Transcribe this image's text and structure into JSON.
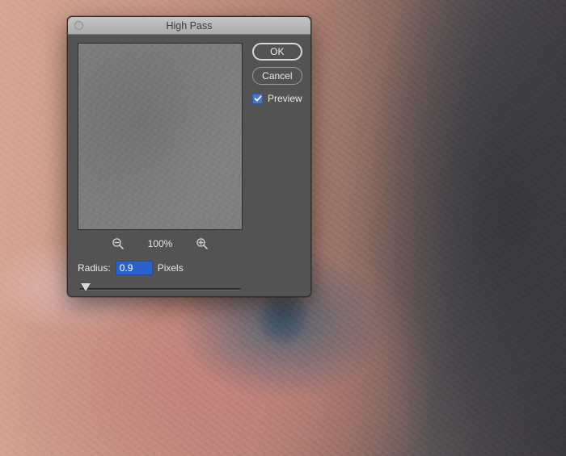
{
  "dialog": {
    "title": "High Pass",
    "ok_label": "OK",
    "cancel_label": "Cancel",
    "preview_label": "Preview",
    "preview_checked": true,
    "zoom_level": "100%",
    "radius_label": "Radius:",
    "radius_value": "0.9",
    "radius_units": "Pixels"
  }
}
